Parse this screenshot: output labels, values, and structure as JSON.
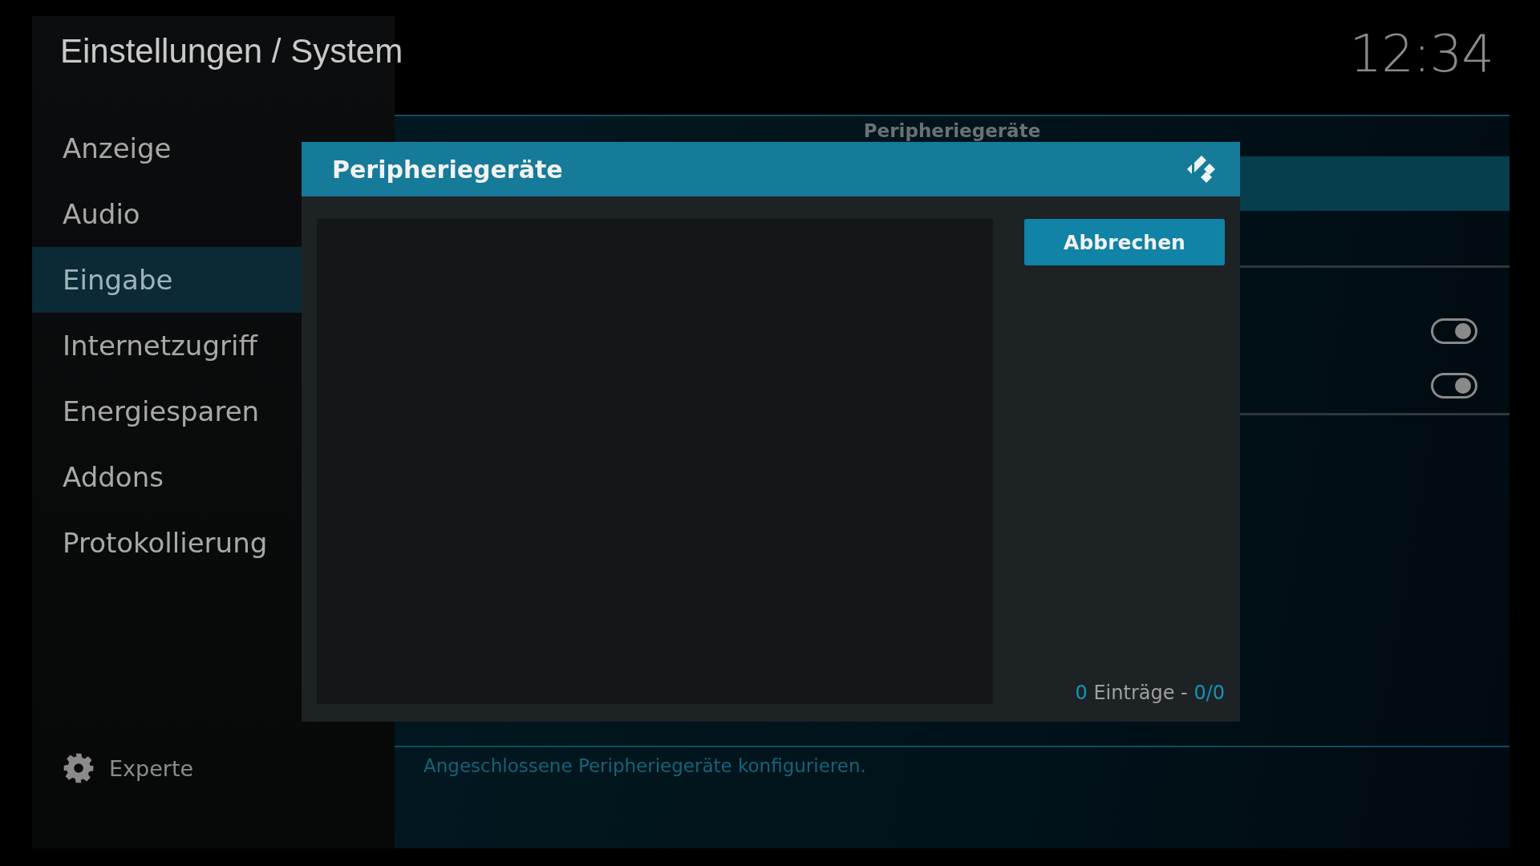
{
  "header": {
    "title": "Einstellungen / System",
    "clock": "12:34"
  },
  "sidebar": {
    "items": [
      {
        "label": "Anzeige",
        "selected": false
      },
      {
        "label": "Audio",
        "selected": false
      },
      {
        "label": "Eingabe",
        "selected": true
      },
      {
        "label": "Internetzugriff",
        "selected": false
      },
      {
        "label": "Energiesparen",
        "selected": false
      },
      {
        "label": "Addons",
        "selected": false
      },
      {
        "label": "Protokollierung",
        "selected": false
      }
    ],
    "footer": {
      "label": "Experte"
    }
  },
  "main": {
    "section_title": "Peripheriegeräte",
    "rows": [
      {
        "kind": "item",
        "focused": true
      },
      {
        "kind": "item"
      },
      {
        "kind": "toggle",
        "on": true
      },
      {
        "kind": "toggle",
        "on": true
      }
    ],
    "description": "Angeschlossene Peripheriegeräte konfigurieren."
  },
  "dialog": {
    "title": "Peripheriegeräte",
    "buttons": [
      "Abbrechen"
    ],
    "count": {
      "items": "0",
      "label": "Einträge -",
      "position": "0/0"
    }
  }
}
